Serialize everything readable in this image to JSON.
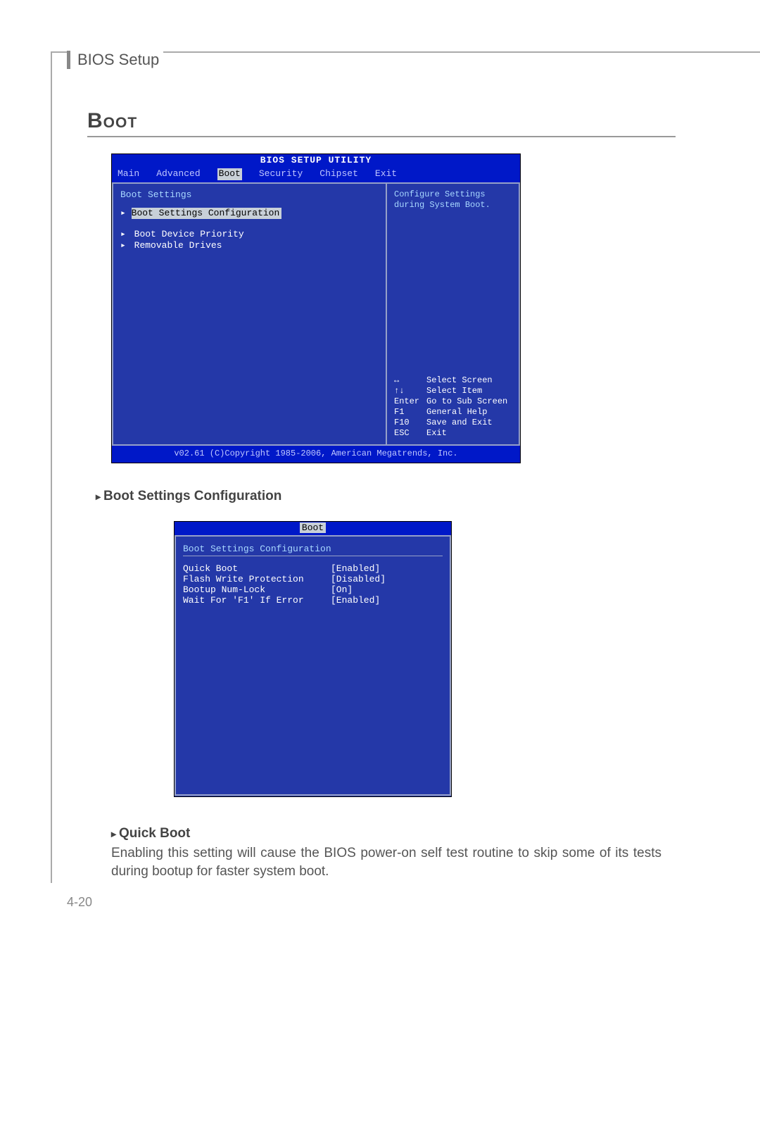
{
  "header": {
    "chapter": "BIOS Setup"
  },
  "section": {
    "title": "Boot"
  },
  "bios1": {
    "title": "BIOS SETUP UTILITY",
    "tabs": [
      "Main",
      "Advanced",
      "Boot",
      "Security",
      "Chipset",
      "Exit"
    ],
    "active_tab_index": 2,
    "left": {
      "heading": "Boot Settings",
      "items": [
        "Boot Settings Configuration",
        "Boot Device Priority",
        "Removable Drives"
      ],
      "selected_index": 0
    },
    "right": {
      "help_lines": [
        "Configure Settings",
        "during System Boot."
      ],
      "nav": [
        {
          "key": "↔",
          "action": "Select Screen"
        },
        {
          "key": "↑↓",
          "action": "Select Item"
        },
        {
          "key": "Enter",
          "action": "Go to Sub Screen"
        },
        {
          "key": "F1",
          "action": "General Help"
        },
        {
          "key": "F10",
          "action": "Save and Exit"
        },
        {
          "key": "ESC",
          "action": "Exit"
        }
      ]
    },
    "footer": "v02.61 (C)Copyright 1985-2006, American Megatrends, Inc."
  },
  "caption1": "Boot Settings Configuration",
  "bios2": {
    "tab": "Boot",
    "heading": "Boot Settings Configuration",
    "rows": [
      {
        "label": "Quick Boot",
        "value": "[Enabled]"
      },
      {
        "label": "Flash Write Protection",
        "value": "[Disabled]"
      },
      {
        "label": "Bootup Num-Lock",
        "value": "[On]"
      },
      {
        "label": "Wait For 'F1' If Error",
        "value": "[Enabled]"
      }
    ]
  },
  "caption2": "Quick Boot",
  "body": "Enabling this setting will cause the BIOS power-on self test routine to skip some of its tests during bootup for faster system boot.",
  "page_number": "4-20"
}
